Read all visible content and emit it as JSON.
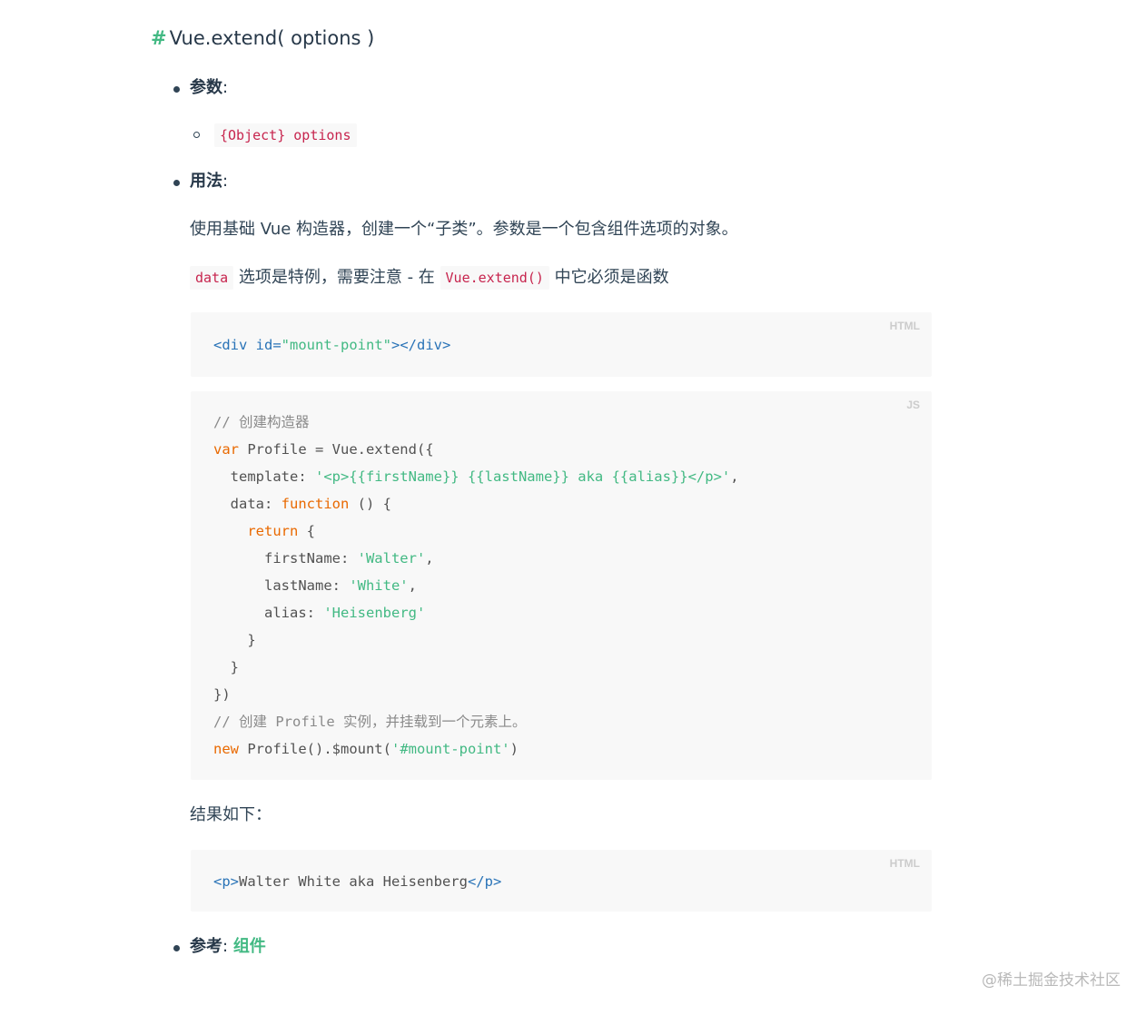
{
  "heading": {
    "hash": "#",
    "title": "Vue.extend( options )"
  },
  "params": {
    "label": "参数",
    "colon": ":",
    "item": "{Object} options"
  },
  "usage": {
    "label": "用法",
    "colon": ":",
    "description": "使用基础 Vue 构造器，创建一个“子类”。参数是一个包含组件选项的对象。",
    "note": {
      "code1": "data",
      "text1": " 选项是特例，需要注意 - 在 ",
      "code2": "Vue.extend()",
      "text2": " 中它必须是函数"
    }
  },
  "code_blocks": {
    "html1": {
      "lang": "HTML"
    },
    "js": {
      "lang": "JS"
    },
    "html2": {
      "lang": "HTML"
    }
  },
  "result_text": "结果如下：",
  "see_also": {
    "label": "参考",
    "colon": ":",
    "link": "组件"
  },
  "watermark": "@稀土掘金技术社区",
  "colors": {
    "accent": "#42b983",
    "keyword": "#e96900",
    "tag": "#2973b7",
    "inline_code": "#c7254e"
  }
}
